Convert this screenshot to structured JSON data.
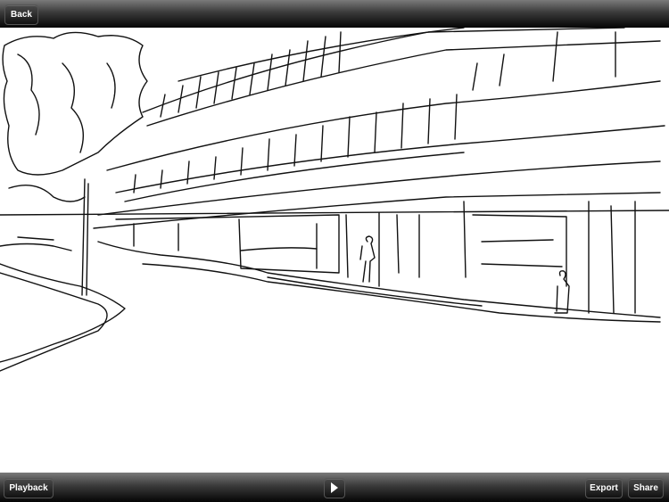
{
  "top_bar": {
    "back_label": "Back"
  },
  "bottom_bar": {
    "playback_label": "Playback",
    "play_icon": "play-icon",
    "export_label": "Export",
    "share_label": "Share"
  }
}
